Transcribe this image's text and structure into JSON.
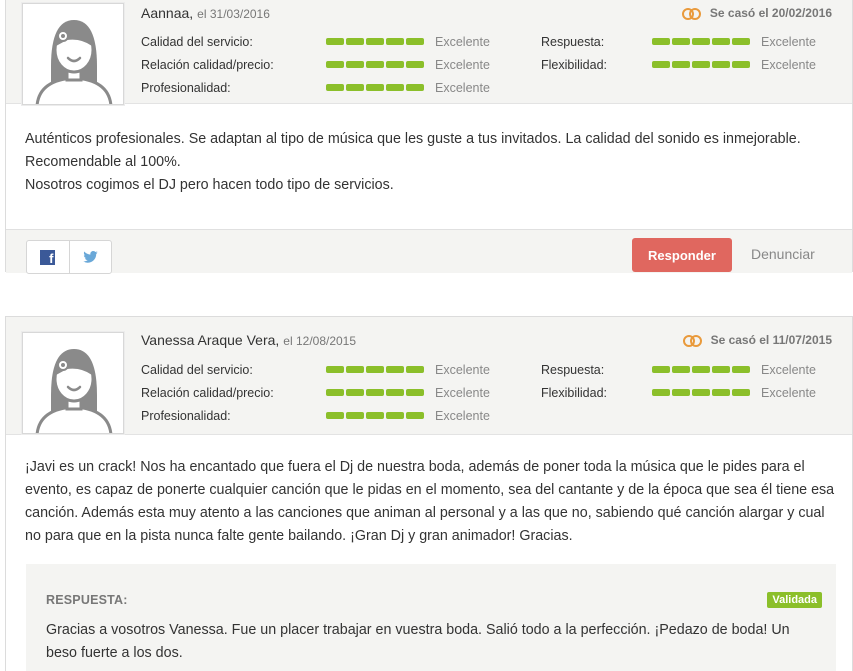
{
  "reviews": [
    {
      "author": "Aannaa,",
      "date": "el 31/03/2016",
      "married": "Se casó el 20/02/2016",
      "ratings": [
        {
          "label": "Calidad del servicio:",
          "value": "Excelente",
          "score": 5
        },
        {
          "label": "Relación calidad/precio:",
          "value": "Excelente",
          "score": 5
        },
        {
          "label": "Profesionalidad:",
          "value": "Excelente",
          "score": 5
        },
        {
          "label": "Respuesta:",
          "value": "Excelente",
          "score": 5
        },
        {
          "label": "Flexibilidad:",
          "value": "Excelente",
          "score": 5
        }
      ],
      "text": [
        "Auténticos profesionales. Se adaptan al tipo de música que les guste a tus invitados. La calidad del sonido es inmejorable.",
        "Recomendable al 100%.",
        "Nosotros cogimos el DJ pero hacen todo tipo de servicios."
      ],
      "actions": {
        "reply": "Responder",
        "report": "Denunciar"
      }
    },
    {
      "author": "Vanessa Araque Vera,",
      "date": "el 12/08/2015",
      "married": "Se casó el 11/07/2015",
      "ratings": [
        {
          "label": "Calidad del servicio:",
          "value": "Excelente",
          "score": 5
        },
        {
          "label": "Relación calidad/precio:",
          "value": "Excelente",
          "score": 5
        },
        {
          "label": "Profesionalidad:",
          "value": "Excelente",
          "score": 5
        },
        {
          "label": "Respuesta:",
          "value": "Excelente",
          "score": 5
        },
        {
          "label": "Flexibilidad:",
          "value": "Excelente",
          "score": 5
        }
      ],
      "text": "¡Javi es un crack! Nos ha encantado que fuera el Dj de nuestra boda, además de poner toda la música que le pides para el evento, es capaz de ponerte cualquier canción que le pidas en el momento, sea del cantante y de la época que sea él tiene esa canción. Además esta muy atento a las canciones que animan al personal y a las que no, sabiendo qué canción alargar y cual no para que en la pista nunca falte gente bailando. ¡Gran Dj y gran animador! Gracias.",
      "response": {
        "title": "RESPUESTA:",
        "badge": "Validada",
        "text": "Gracias a vosotros Vanessa. Fue un placer trabajar en vuestra boda. Salió todo a la perfección. ¡Pedazo de boda! Un beso fuerte a los dos."
      }
    }
  ],
  "colors": {
    "bar": "#8bbf2a",
    "reply_button": "#e0675f",
    "rings": "#e99a3c",
    "facebook": "#3b5998",
    "twitter": "#55acee"
  },
  "icons": {
    "avatar": "default-bride-avatar-icon",
    "married": "wedding-rings-icon",
    "share": [
      "facebook-icon",
      "twitter-icon"
    ]
  }
}
